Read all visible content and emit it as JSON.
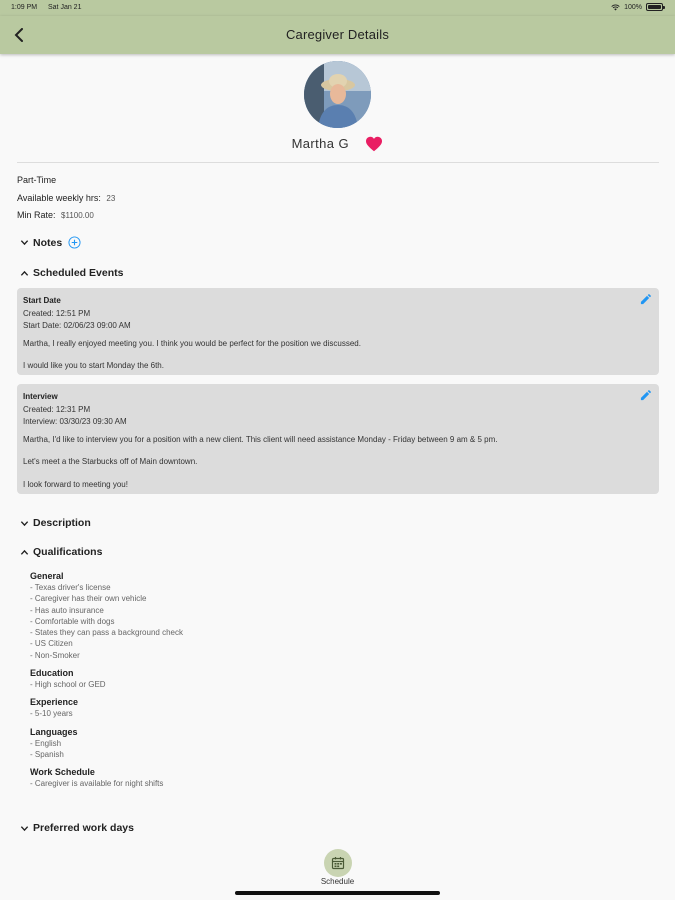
{
  "status": {
    "time": "1:09 PM",
    "date": "Sat Jan 21",
    "battery": "100%"
  },
  "appbar": {
    "title": "Caregiver Details",
    "back_icon": "chevron-left-icon"
  },
  "profile": {
    "name": "Martha G",
    "favorite": true,
    "heart_color": "#e91e63"
  },
  "info": {
    "employment_type": "Part-Time",
    "weekly_hours_label": "Available weekly hrs:",
    "weekly_hours_value": "23",
    "min_rate_label": "Min Rate:",
    "min_rate_value": "$1100.00"
  },
  "sections": {
    "notes": "Notes",
    "scheduled_events": "Scheduled Events",
    "description": "Description",
    "qualifications": "Qualifications",
    "preferred_work_days": "Preferred work days"
  },
  "events": [
    {
      "title": "Start Date",
      "created": "Created: 12:51 PM",
      "when": "Start Date: 02/06/23 09:00 AM",
      "body": [
        "Martha, I really enjoyed meeting you. I think you would be perfect for the position we discussed.",
        "I would like you to start Monday the 6th."
      ]
    },
    {
      "title": "Interview",
      "created": "Created: 12:31 PM",
      "when": "Interview: 03/30/23 09:30 AM",
      "body": [
        "Martha, I'd like to interview you for a position with a new client. This client will need assistance Monday - Friday between 9 am & 5 pm.",
        "Let's meet a the Starbucks off of Main downtown.",
        "I look forward to meeting you!"
      ]
    }
  ],
  "qualifications": {
    "general_title": "General",
    "general": [
      "- Texas driver's license",
      "- Caregiver has their own vehicle",
      "- Has auto insurance",
      "- Comfortable with dogs",
      "- States they can pass a background check",
      "- US Citizen",
      "- Non-Smoker"
    ],
    "education_title": "Education",
    "education": [
      "- High school or GED"
    ],
    "experience_title": "Experience",
    "experience": [
      "- 5-10 years"
    ],
    "languages_title": "Languages",
    "languages": [
      "- English",
      "- Spanish"
    ],
    "work_schedule_title": "Work Schedule",
    "work_schedule": [
      "- Caregiver is available for night shifts"
    ]
  },
  "bottom_nav": {
    "schedule_label": "Schedule"
  },
  "colors": {
    "appbar": "#b9c9a0",
    "card": "#dcdcdc",
    "accent": "#2196f3"
  }
}
